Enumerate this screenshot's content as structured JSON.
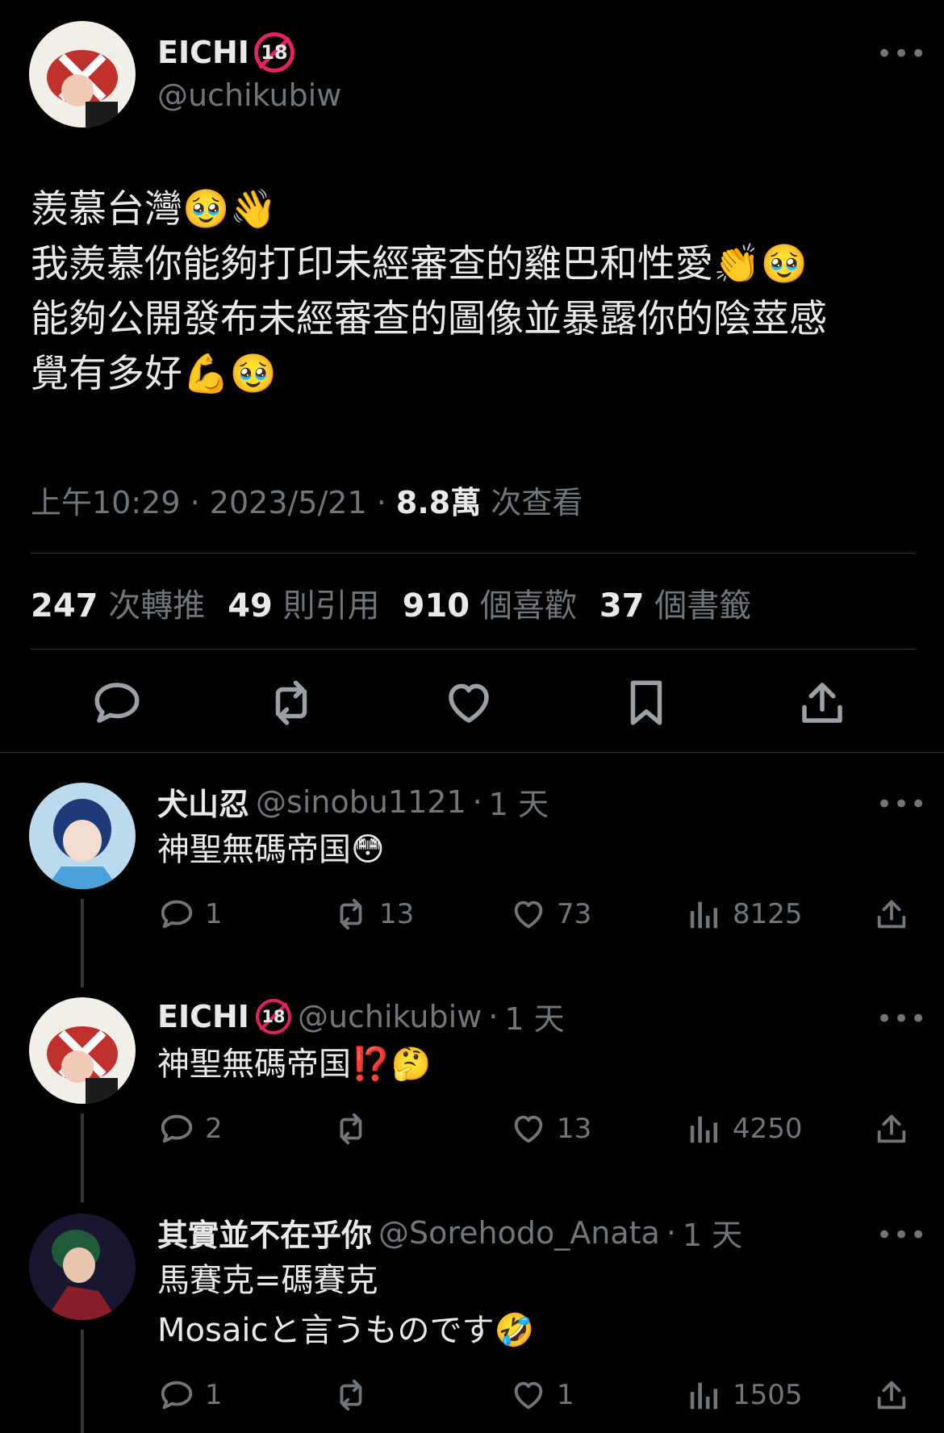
{
  "main_tweet": {
    "author_name": "EICHI",
    "age_badge": "18",
    "handle": "@uchikubiw",
    "text": "羨慕台灣🥹👋\n我羨慕你能夠打印未經審查的雞巴和性愛👏🥹\n能夠公開發布未經審查的圖像並暴露你的陰莖感\n覺有多好💪🥹",
    "time": "上午10:29",
    "date": "2023/5/21",
    "views_count": "8.8萬",
    "views_label": "次查看",
    "retweets_count": "247",
    "retweets_label": "次轉推",
    "quotes_count": "49",
    "quotes_label": "則引用",
    "likes_count": "910",
    "likes_label": "個喜歡",
    "bookmarks_count": "37",
    "bookmarks_label": "個書籤",
    "more_glyph": "•••"
  },
  "replies": [
    {
      "author_name": "犬山忍",
      "handle": "@sinobu1121",
      "time": "1 天",
      "text": "神聖無碼帝国😳",
      "reply_count": "1",
      "retweet_count": "13",
      "like_count": "73",
      "view_count": "8125"
    },
    {
      "author_name": "EICHI",
      "age_badge": "18",
      "handle": "@uchikubiw",
      "time": "1 天",
      "text": "神聖無碼帝国⁉️🤔",
      "reply_count": "2",
      "retweet_count": "",
      "like_count": "13",
      "view_count": "4250"
    },
    {
      "author_name": "其實並不在乎你",
      "handle": "@Sorehodo_Anata",
      "time": "1 天",
      "text": "馬賽克=碼賽克\nMosaicと言うものです🤣",
      "reply_count": "1",
      "retweet_count": "",
      "like_count": "1",
      "view_count": "1505"
    }
  ],
  "colors": {
    "background": "#000000",
    "text_primary": "#e7e9ea",
    "text_secondary": "#71767b",
    "divider": "#2f3336",
    "badge": "#e0245e"
  }
}
